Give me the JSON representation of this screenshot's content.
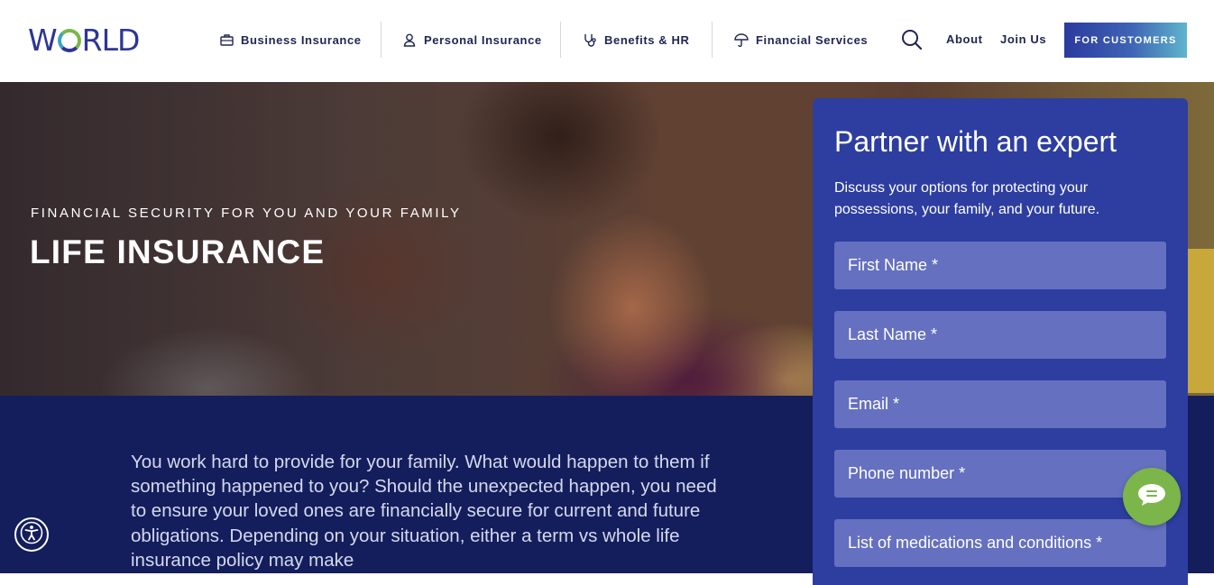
{
  "header": {
    "logo_text_left": "W",
    "logo_text_right": "RLD",
    "nav": [
      {
        "label": "Business Insurance",
        "icon": "briefcase-icon"
      },
      {
        "label": "Personal Insurance",
        "icon": "person-icon"
      },
      {
        "label": "Benefits & HR",
        "icon": "stethoscope-icon"
      },
      {
        "label": "Financial Services",
        "icon": "umbrella-icon"
      }
    ],
    "search_icon": "search-icon",
    "about": "About",
    "join": "Join Us",
    "cta": "FOR CUSTOMERS"
  },
  "hero": {
    "eyebrow": "FINANCIAL SECURITY FOR YOU AND YOUR FAMILY",
    "title": "LIFE INSURANCE"
  },
  "body": {
    "text": "You work hard to provide for your family. What would happen to them if something happened to you? Should the unexpected happen, you need to ensure your loved ones are financially secure for current and future obligations. Depending on your situation, either a term vs whole life insurance policy may make"
  },
  "form": {
    "title": "Partner with an expert",
    "subtitle": "Discuss your options for protecting your possessions, your family, and your future.",
    "fields": [
      {
        "placeholder": "First Name *"
      },
      {
        "placeholder": "Last Name *"
      },
      {
        "placeholder": "Email *"
      },
      {
        "placeholder": "Phone number *"
      },
      {
        "placeholder": "List of medications and conditions *"
      }
    ]
  },
  "widgets": {
    "accessibility_icon": "accessibility-icon",
    "chat_icon": "chat-icon"
  },
  "colors": {
    "brand_navy": "#141e5c",
    "panel_blue": "#2d3ea0",
    "field_blue": "#6570c0",
    "logo_green": "#7ab648",
    "chat_green": "#7cb54a"
  }
}
